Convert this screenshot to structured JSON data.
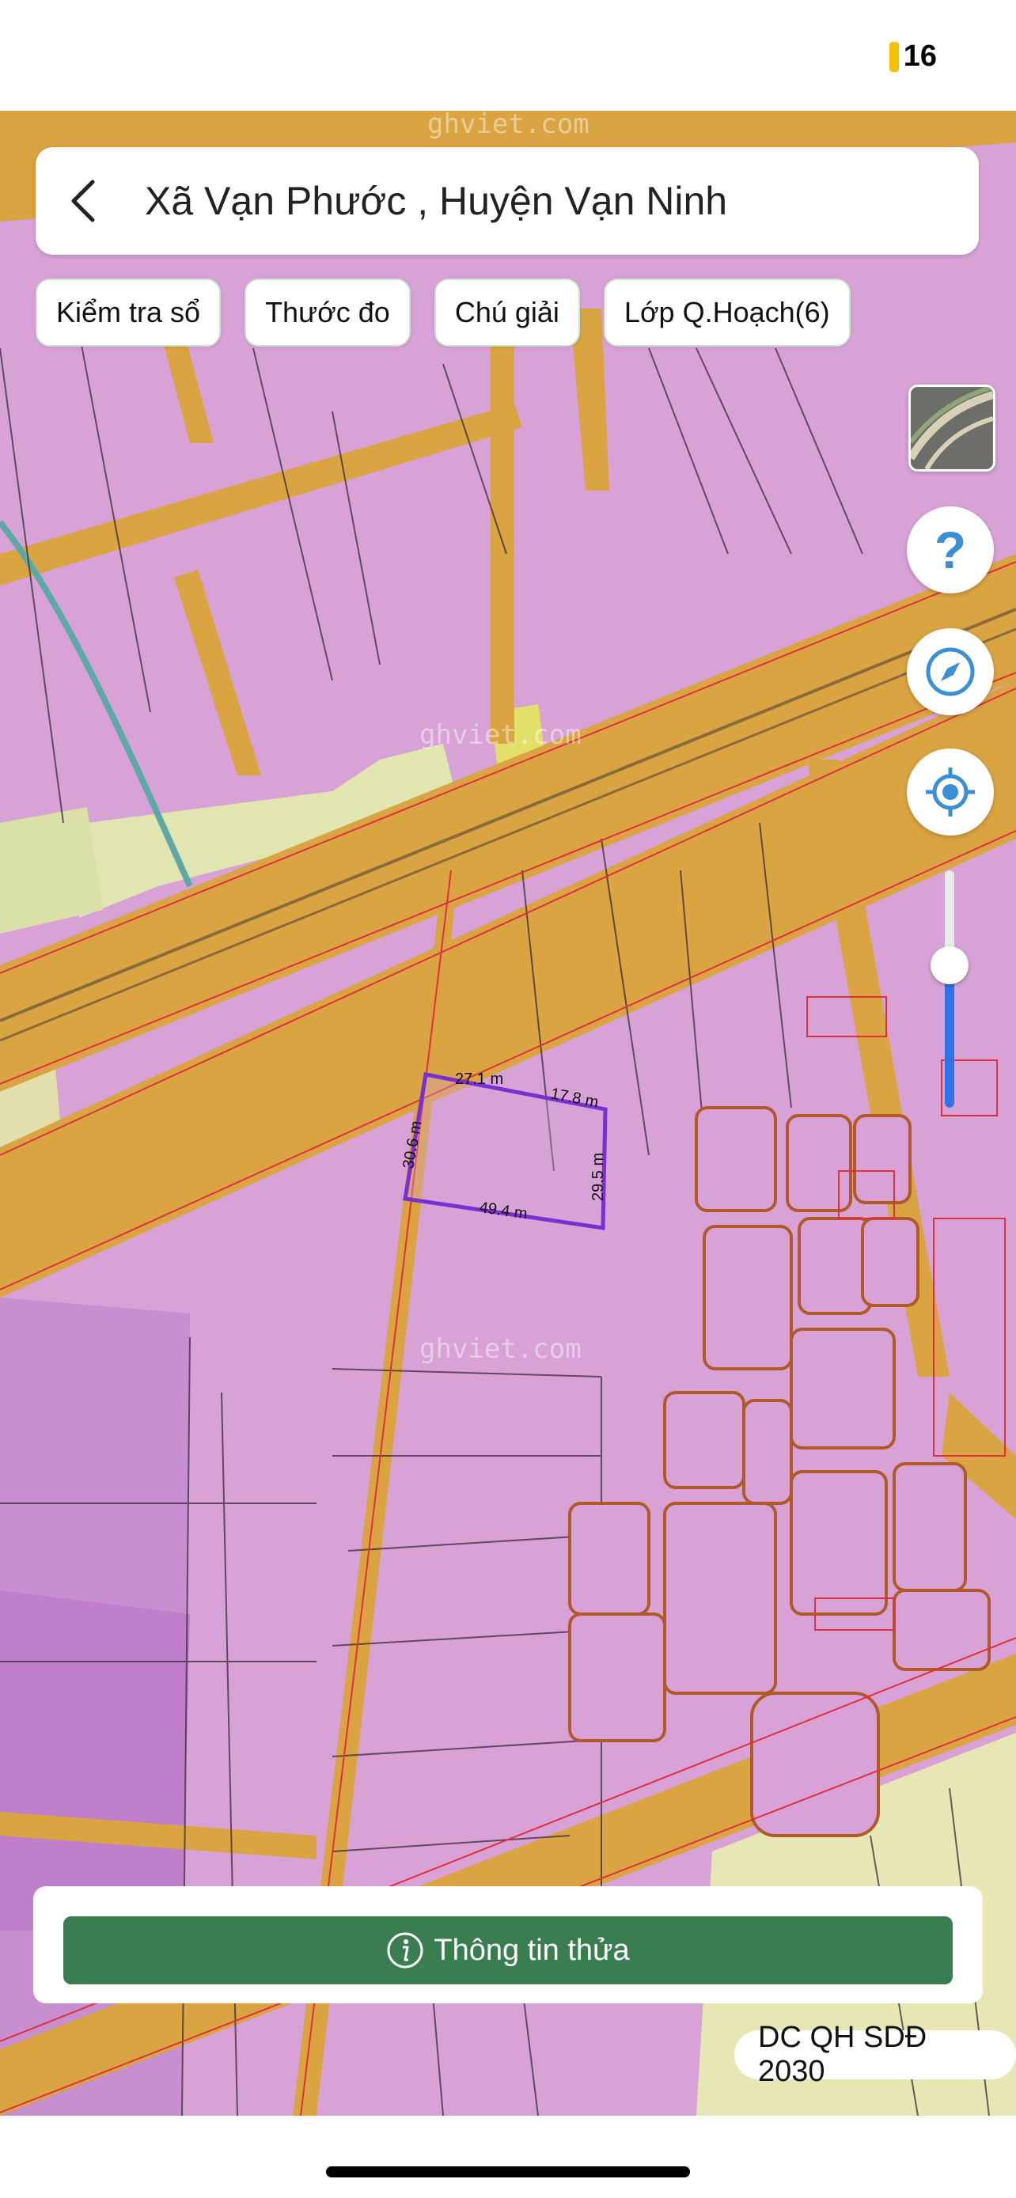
{
  "status_bar": {
    "battery_level": "16",
    "battery_color": "#f2c200"
  },
  "header": {
    "title": "Xã Vạn Phước , Huyện Vạn Ninh",
    "back_icon": "chevron-left-icon"
  },
  "toolbar": {
    "chips": [
      "Kiểm tra sổ",
      "Thước đo",
      "Chú giải",
      "Lớp Q.Hoạch(6)"
    ]
  },
  "map": {
    "watermark": "ghviet.com",
    "parcel_measurements": [
      "27.1 m",
      "17.8 m",
      "29.5 m",
      "49.4 m",
      "30.6 m"
    ],
    "colors": {
      "residential": "#d8a2d6",
      "road": "#d9a441",
      "agriculture": "#e3e6a8",
      "selected_parcel": "#7a2fd0"
    }
  },
  "controls": {
    "help_icon": "question-icon",
    "compass_icon": "compass-icon",
    "location_icon": "locate-icon",
    "zoom_level_fraction": 0.6
  },
  "bottom": {
    "info_button_label": "Thông tin thửa",
    "info_icon": "info-icon"
  },
  "plan_badge": "DC QH SDĐ 2030"
}
